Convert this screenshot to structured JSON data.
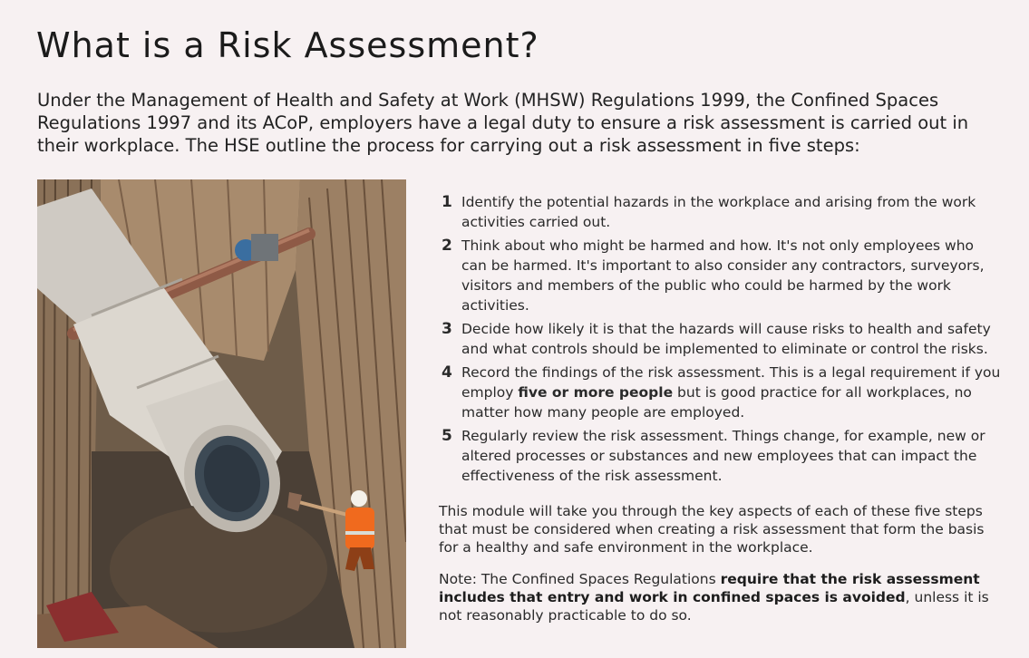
{
  "page": {
    "title": "What is a Risk Assessment?",
    "intro": "Under the Management of Health and Safety at Work (MHSW) Regulations 1999, the Confined Spaces Regulations 1997 and its ACoP, employers have a legal duty to ensure a risk assessment is carried out in their workplace. The HSE outline the process for carrying out a risk assessment in five steps:"
  },
  "steps": [
    {
      "number": "1",
      "text": "Identify the potential hazards in the workplace and arising from the work activities carried out."
    },
    {
      "number": "2",
      "text": "Think about who might be harmed and how. It's not only employees who can be harmed. It's important to also consider any contractors, surveyors, visitors and members of the public who could be harmed by the work activities."
    },
    {
      "number": "3",
      "text": "Decide how likely it is that the hazards will cause risks to health and safety and what controls should be implemented to eliminate or control the risks."
    },
    {
      "number": "4",
      "text_before": "Record the findings of the risk assessment. This is a legal requirement if you employ ",
      "text_bold": "five or more people",
      "text_after": " but is good practice for all workplaces, no matter how many people are employed."
    },
    {
      "number": "5",
      "text": "Regularly review the risk assessment. Things change, for example, new or altered processes or substances and new employees that can impact the effectiveness of the risk assessment."
    }
  ],
  "module_text": "This module will take you through the key aspects of each of these five steps that must be considered when creating a risk assessment that form the basis for a healthy and safe environment in the workplace.",
  "note": {
    "before": "Note: The Confined Spaces Regulations ",
    "bold": "require that the risk assessment includes that entry and work in confined spaces is avoided",
    "after": ", unless it is not reasonably practicable to do so."
  },
  "image": {
    "subject": "Worker in orange hi-vis and white hard hat shovelling in a timber-shored trench beside large concrete pipe sections"
  },
  "colors": {
    "background": "#f7f1f2",
    "text": "#222222",
    "hi_vis": "#f06a1e"
  }
}
